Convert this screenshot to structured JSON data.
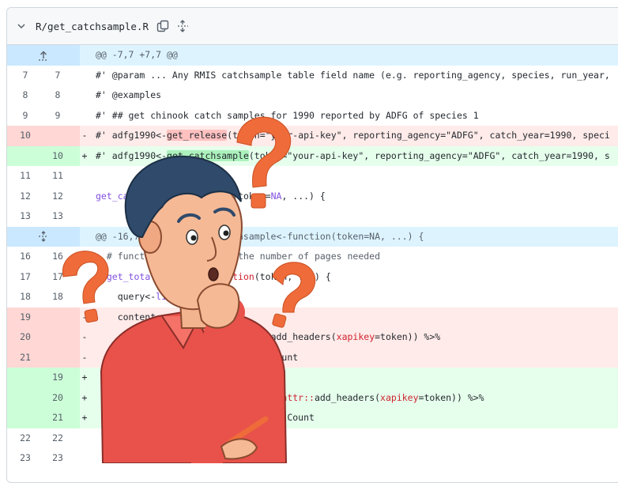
{
  "file": {
    "path": "R/get_catchsample.R"
  },
  "hunks": [
    {
      "header": "@@ -7,7 +7,7 @@"
    },
    {
      "header": "@@ -16,7 +16,7 @@ get_catchsample<-function(token=NA, ...) {"
    }
  ],
  "lines": [
    {
      "old": "7",
      "new": "7",
      "type": "ctx",
      "sign": "",
      "segments": [
        {
          "t": "#' @param ... Any RMIS catchsample table field name (e.g. reporting_agency, species, run_year,",
          "c": "cb"
        }
      ]
    },
    {
      "old": "8",
      "new": "8",
      "type": "ctx",
      "sign": "",
      "segments": [
        {
          "t": "#' @examples",
          "c": "cb"
        }
      ]
    },
    {
      "old": "9",
      "new": "9",
      "type": "ctx",
      "sign": "",
      "segments": [
        {
          "t": "#' ## get chinook catch samples for 1990 reported by ADFG of species 1",
          "c": "cb"
        }
      ]
    },
    {
      "old": "10",
      "new": "",
      "type": "del",
      "sign": "-",
      "segments": [
        {
          "t": "#' adfg1990<-",
          "c": "cb"
        },
        {
          "t": "get_release",
          "c": "hl-del"
        },
        {
          "t": "(token=\"your-api-key\", reporting_agency=\"ADFG\", catch_year=1990, speci",
          "c": "cb"
        }
      ]
    },
    {
      "old": "",
      "new": "10",
      "type": "add",
      "sign": "+",
      "segments": [
        {
          "t": "#' adfg1990<-",
          "c": "cb"
        },
        {
          "t": "get_catchsample",
          "c": "hl-add"
        },
        {
          "t": "(token=\"your-api-key\", reporting_agency=\"ADFG\", catch_year=1990, s",
          "c": "cb"
        }
      ]
    },
    {
      "old": "11",
      "new": "11",
      "type": "ctx",
      "sign": "",
      "segments": [
        {
          "t": "",
          "c": "cb"
        }
      ]
    },
    {
      "old": "12",
      "new": "12",
      "type": "ctx",
      "sign": "",
      "segments": [
        {
          "t": "get_catchsample",
          "c": "fn"
        },
        {
          "t": "<-",
          "c": "cb"
        },
        {
          "t": "function",
          "c": "kw"
        },
        {
          "t": "(token=",
          "c": "cb"
        },
        {
          "t": "NA",
          "c": "fn"
        },
        {
          "t": ", ...) {",
          "c": "cb"
        }
      ]
    },
    {
      "old": "13",
      "new": "13",
      "type": "ctx",
      "sign": "",
      "segments": [
        {
          "t": "",
          "c": "cb"
        }
      ]
    },
    {
      "hunk": 1
    },
    {
      "old": "16",
      "new": "16",
      "type": "ctx",
      "sign": "",
      "segments": [
        {
          "t": "  # function to determine the number of pages needed",
          "c": "cm"
        }
      ]
    },
    {
      "old": "17",
      "new": "17",
      "type": "ctx",
      "sign": "",
      "segments": [
        {
          "t": "  ",
          "c": "cb"
        },
        {
          "t": "get_total_records",
          "c": "fn"
        },
        {
          "t": "<-",
          "c": "cb"
        },
        {
          "t": "function",
          "c": "kw"
        },
        {
          "t": "(token, ...) {",
          "c": "cb"
        }
      ]
    },
    {
      "old": "18",
      "new": "18",
      "type": "ctx",
      "sign": "",
      "segments": [
        {
          "t": "    query<-",
          "c": "cb"
        },
        {
          "t": "list",
          "c": "fn"
        },
        {
          "t": "(...)",
          "c": "cb"
        }
      ]
    },
    {
      "old": "19",
      "new": "",
      "type": "del",
      "sign": "-",
      "segments": [
        {
          "t": "    content<-",
          "c": "cb"
        }
      ]
    },
    {
      "old": "20",
      "new": "",
      "type": "del",
      "sign": "-",
      "segments": [
        {
          "t": "                          ",
          "c": "cb"
        },
        {
          "t": "httr::",
          "c": "kw"
        },
        {
          "t": "add_headers(",
          "c": "cb"
        },
        {
          "t": "xapikey",
          "c": "kw"
        },
        {
          "t": "=token)) %>%",
          "c": "cb"
        }
      ]
    },
    {
      "old": "21",
      "new": "",
      "type": "del",
      "sign": "-",
      "segments": [
        {
          "t": "                          $totalCount",
          "c": "cb"
        }
      ]
    },
    {
      "old": "",
      "new": "19",
      "type": "add",
      "sign": "+",
      "segments": [
        {
          "t": "",
          "c": "cb"
        }
      ]
    },
    {
      "old": "",
      "new": "20",
      "type": "add",
      "sign": "+",
      "segments": [
        {
          "t": "                     query=query, ",
          "c": "cb"
        },
        {
          "t": "httr::",
          "c": "kw"
        },
        {
          "t": "add_headers(",
          "c": "cb"
        },
        {
          "t": "xapikey",
          "c": "kw"
        },
        {
          "t": "=token)) %>%",
          "c": "cb"
        }
      ]
    },
    {
      "old": "",
      "new": "21",
      "type": "add",
      "sign": "+",
      "segments": [
        {
          "t": "                     status()$totalCount",
          "c": "cb"
        }
      ]
    },
    {
      "old": "22",
      "new": "22",
      "type": "ctx",
      "sign": "",
      "segments": [
        {
          "t": "",
          "c": "cb"
        }
      ]
    },
    {
      "old": "23",
      "new": "23",
      "type": "ctx",
      "sign": "",
      "segments": [
        {
          "t": "",
          "c": "cb"
        }
      ]
    }
  ],
  "colors": {
    "accent_blue": "#ddf4ff",
    "del_bg": "#ffebe9",
    "add_bg": "#e6ffec",
    "question_mark": "#ef6c3a",
    "shirt": "#e8524a"
  },
  "icons": [
    "chevron-down-icon",
    "copy-icon",
    "expand-up-icon",
    "expand-both-icon"
  ]
}
